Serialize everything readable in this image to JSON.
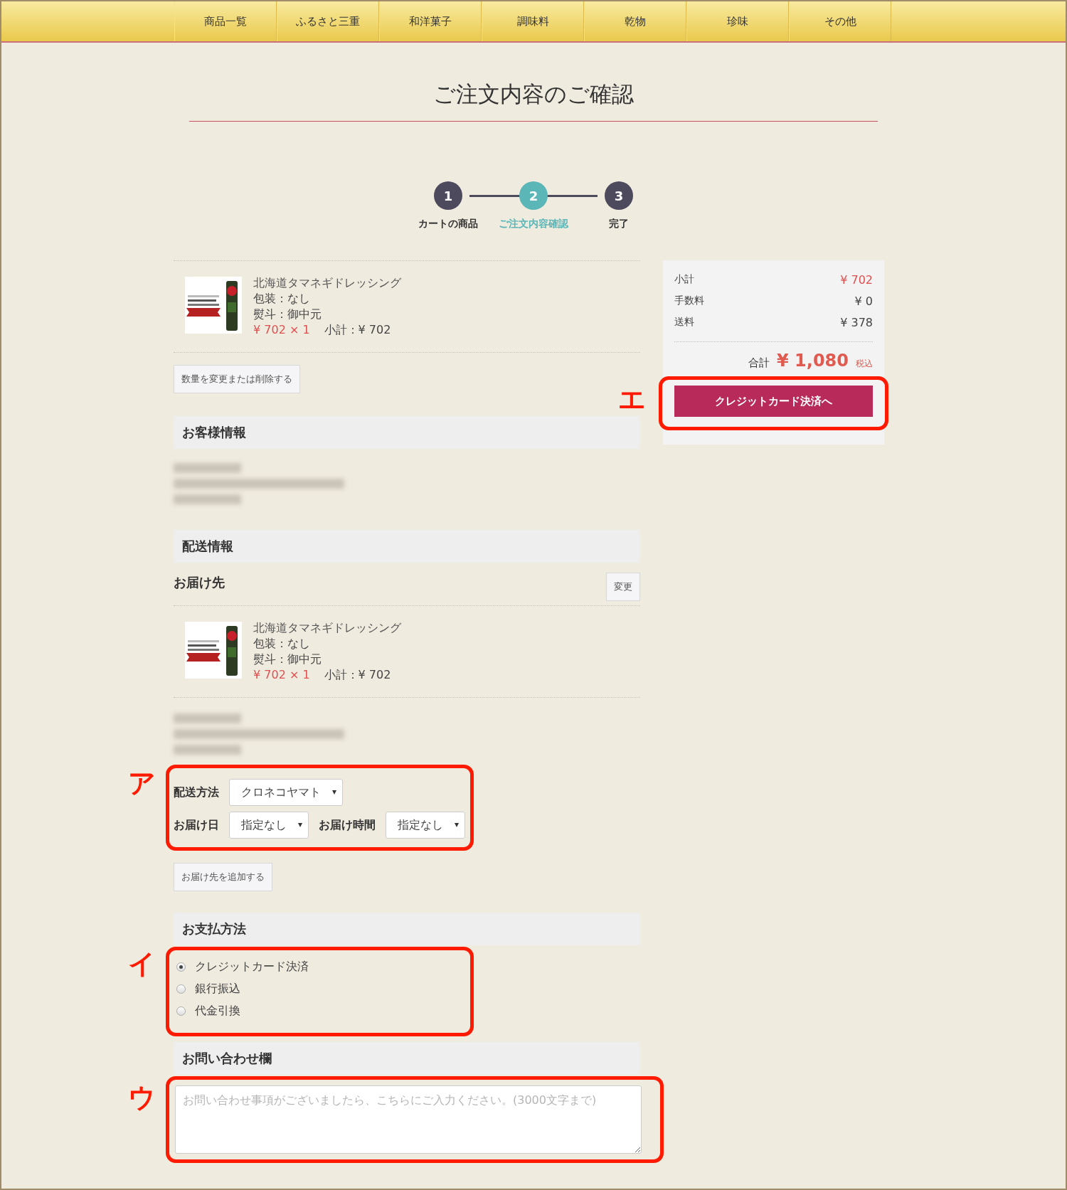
{
  "nav": [
    "商品一覧",
    "ふるさと三重",
    "和洋菓子",
    "調味料",
    "乾物",
    "珍味",
    "その他"
  ],
  "page_title": "ご注文内容のご確認",
  "steps": [
    {
      "number": "1",
      "label": "カートの商品",
      "selected": false
    },
    {
      "number": "2",
      "label": "ご注文内容確認",
      "selected": true
    },
    {
      "number": "3",
      "label": "完了",
      "selected": false
    }
  ],
  "cart_items": [
    {
      "name": "北海道タマネギドレッシング",
      "wrapping": "包装：なし",
      "noshi": "熨斗：御中元",
      "price": "¥ 702 × 1",
      "subtotal": "小計：¥ 702"
    }
  ],
  "edit_button": "数量を変更または削除する",
  "customer": {
    "heading": "お客様情報",
    "lines": [
      {
        "kind": "redacted"
      },
      {
        "kind": "redacted"
      },
      {
        "kind": "redacted"
      }
    ]
  },
  "shipping": {
    "heading": "配送情報",
    "destination_label": "お届け先",
    "change_button": "変更",
    "items": [
      {
        "name": "北海道タマネギドレッシング",
        "wrapping": "包装：なし",
        "noshi": "熨斗：御中元",
        "price": "¥ 702 × 1",
        "subtotal": "小計：¥ 702"
      }
    ],
    "address_lines": [
      {
        "kind": "redacted"
      },
      {
        "kind": "redacted"
      },
      {
        "kind": "redacted"
      }
    ],
    "annotation": "ア",
    "method": {
      "label": "配送方法",
      "value": "クロネコヤマト"
    },
    "date": {
      "label": "お届け日",
      "value": "指定なし"
    },
    "time": {
      "label": "お届け時間",
      "value": "指定なし"
    }
  },
  "add_destination_button": "お届け先を追加する",
  "payment": {
    "heading": "お支払方法",
    "annotation": "イ",
    "options": [
      {
        "label": "クレジットカード決済",
        "selected": true
      },
      {
        "label": "銀行振込",
        "selected": false
      },
      {
        "label": "代金引換",
        "selected": false
      }
    ]
  },
  "inquiry": {
    "heading": "お問い合わせ欄",
    "annotation": "ウ",
    "placeholder": "お問い合わせ事項がございましたら、こちらにご入力ください。(3000文字まで)"
  },
  "summary": {
    "rows": [
      {
        "label": "小計",
        "value": "¥ 702",
        "highlight": true
      },
      {
        "label": "手数料",
        "value": "¥ 0",
        "highlight": false
      },
      {
        "label": "送料",
        "value": "¥ 378",
        "highlight": false
      }
    ],
    "total_label": "合計",
    "total_value": "¥ 1,080",
    "tax_note": "税込",
    "checkout_button": "クレジットカード決済へ",
    "annotation": "エ"
  }
}
